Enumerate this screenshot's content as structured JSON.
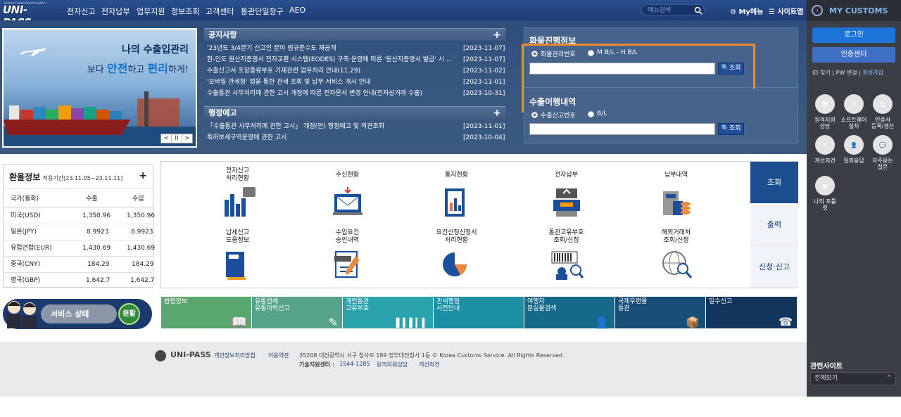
{
  "header": {
    "logo_small": "Electronic Customs Clearance System",
    "logo": "UNI-PASS",
    "nav": [
      "전자신고",
      "전자납부",
      "업무지원",
      "정보조회",
      "고객센터",
      "통관단일창구",
      "AEO"
    ],
    "search_placeholder": "메뉴검색",
    "my_menu": "My메뉴",
    "sitemap": "사이트맵"
  },
  "banner": {
    "line1": "나의 수출입관리",
    "line2_pre": "보다 ",
    "line2_em1": "안전",
    "line2_mid": "하고 ",
    "line2_em2": "편리",
    "line2_post": "하게!",
    "ctrl": [
      "<",
      "II",
      ">"
    ]
  },
  "notice": {
    "title": "공지사항",
    "items": [
      {
        "text": "'23년도 3/4분기 신고인 분야 법규준수도 재공개",
        "date": "[2023-11-07]"
      },
      {
        "text": "한-인도 원산지증명서 전자교환 시스템(EODES) 구축·운영에 따른 '원산지증명서 발급' 시 ...",
        "date": "[2023-11-07]"
      },
      {
        "text": "수출신고서 포장종류부호 기재관련 업무처리 안내(11.29)",
        "date": "[2023-11-02]"
      },
      {
        "text": "'모바일 관세청' 앱을 통한 관세 조회 및 납부 서비스 개시 안내",
        "date": "[2023-11-01]"
      },
      {
        "text": "수출통관 사무처리에 관한 고시 개정에 따른 전자문서 변경 안내(전자상거래 수출)",
        "date": "[2023-10-31]"
      }
    ]
  },
  "admin_notice": {
    "title": "행정예고",
    "items": [
      {
        "text": "「수출통관 사무처리에 관한 고시」 개정(안) 행정예고 및 의견조회",
        "date": "[2023-11-01]"
      },
      {
        "text": "특허보세구역운영에 관한 고시",
        "date": "[2023-10-04]"
      }
    ]
  },
  "cargo": {
    "title": "화물진행정보",
    "opt1": "화물관리번호",
    "opt2": "M B/L - H B/L",
    "btn": "조회"
  },
  "export": {
    "title": "수출이행내역",
    "opt1": "수출신고번호",
    "opt2": "B/L",
    "btn": "조회"
  },
  "fx": {
    "title": "환율정보",
    "period": "적용기간[23.11.05~23.11.11]",
    "cols": [
      "국가(통화)",
      "수출",
      "수입"
    ],
    "rows": [
      {
        "c": "미국(USD)",
        "e": "1,350.96",
        "i": "1,350.96"
      },
      {
        "c": "일본(JPY)",
        "e": "8.9923",
        "i": "8.9923"
      },
      {
        "c": "유럽연합(EUR)",
        "e": "1,430.69",
        "i": "1,430.69"
      },
      {
        "c": "중국(CNY)",
        "e": "184.29",
        "i": "184.29"
      },
      {
        "c": "영국(GBP)",
        "e": "1,642.7",
        "i": "1,642.7"
      }
    ]
  },
  "grid": {
    "cells": [
      "전자신고\n처리현황",
      "수신현황",
      "통지현황",
      "전자납부",
      "납부내역",
      "납세신고\n도움정보",
      "수입요건\n승인내역",
      "요건신청신청서\n처리현황",
      "통관고유부호\n조회/신청",
      "해외거래처\n조회/신청"
    ],
    "tabs": [
      "조회",
      "출력",
      "신청·신고"
    ]
  },
  "service": {
    "label": "서비스 상태",
    "status": "원활"
  },
  "tiles": [
    {
      "label": "법령정보",
      "color": "#5aa86f"
    },
    {
      "label": "유통업체\n유통이력신고",
      "color": "#55a38a"
    },
    {
      "label": "개인통관\n고유부호",
      "color": "#2aa3ad"
    },
    {
      "label": "관세행정\n사전안내",
      "color": "#1c8fa5"
    },
    {
      "label": "여행자\n분실물검색",
      "color": "#156a8b"
    },
    {
      "label": "국제우편물\n통관",
      "color": "#174f79"
    },
    {
      "label": "밀수신고",
      "color": "#12355d"
    }
  ],
  "footer": {
    "brand": "UNI-PASS",
    "privacy": "개인정보처리방침",
    "terms": "이용약관",
    "address": "35208 대전광역시 서구 청사로 189 정부대전청사 1동 © Korea Customs Service. All Rights Reserved.",
    "support_label": "기술지원센터 :",
    "phone": "1544-1285",
    "remote": "원격지원상담",
    "suggest": "개선의견"
  },
  "side": {
    "title": "MY CUSTOMS",
    "login": "로그인",
    "cert": "인증센터",
    "links": [
      "ID 찾기",
      "PW 변경",
      "회원가입"
    ],
    "icons": [
      "원격지원\n상담",
      "소프트웨어\n설치",
      "인증서\n등록/갱신",
      "개선의견",
      "질의응답",
      "자주묻는\n질문",
      "나의 포틀\n릿"
    ],
    "related": "관련사이트",
    "related_select": "전체보기"
  },
  "colors": {
    "orange_highlight": "#f08a2d",
    "nav_bg": "#1d3d76",
    "status_green": "#2e8b3a"
  }
}
